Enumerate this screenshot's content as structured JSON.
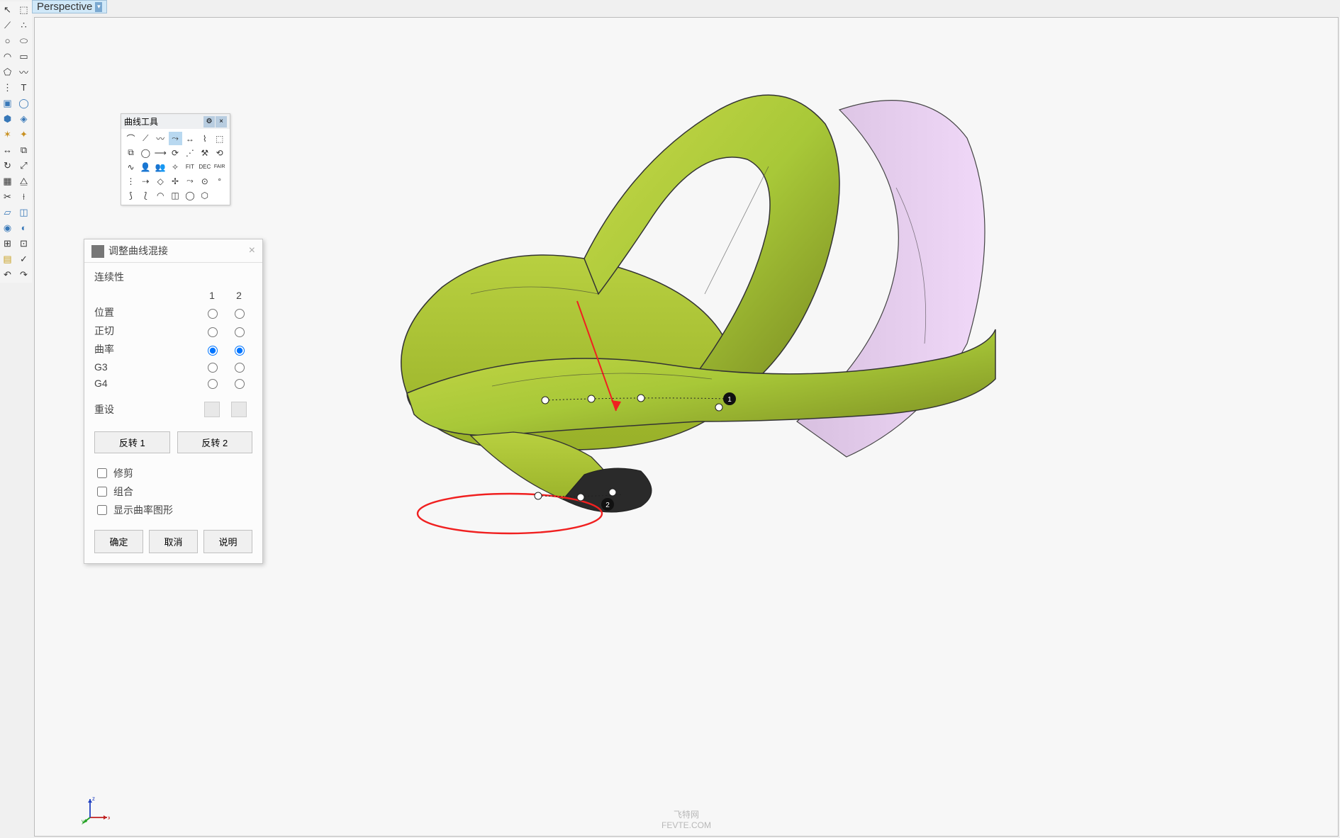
{
  "viewport": {
    "name": "Perspective"
  },
  "curveTools": {
    "title": "曲线工具"
  },
  "blendDialog": {
    "title": "调整曲线混接",
    "continuity": "连续性",
    "col1": "1",
    "col2": "2",
    "rows": {
      "position": "位置",
      "tangent": "正切",
      "curvature": "曲率",
      "g3": "G3",
      "g4": "G4",
      "reset": "重设"
    },
    "flip1": "反转 1",
    "flip2": "反转 2",
    "trim": "修剪",
    "join": "组合",
    "showCurvature": "显示曲率图形",
    "ok": "确定",
    "cancel": "取消",
    "help": "说明"
  },
  "axes": {
    "x": "x",
    "y": "y",
    "z": "z"
  },
  "watermark": {
    "line1": "飞特网",
    "line2": "FEVTE.COM"
  },
  "model": {
    "point1": "1",
    "point2": "2"
  }
}
